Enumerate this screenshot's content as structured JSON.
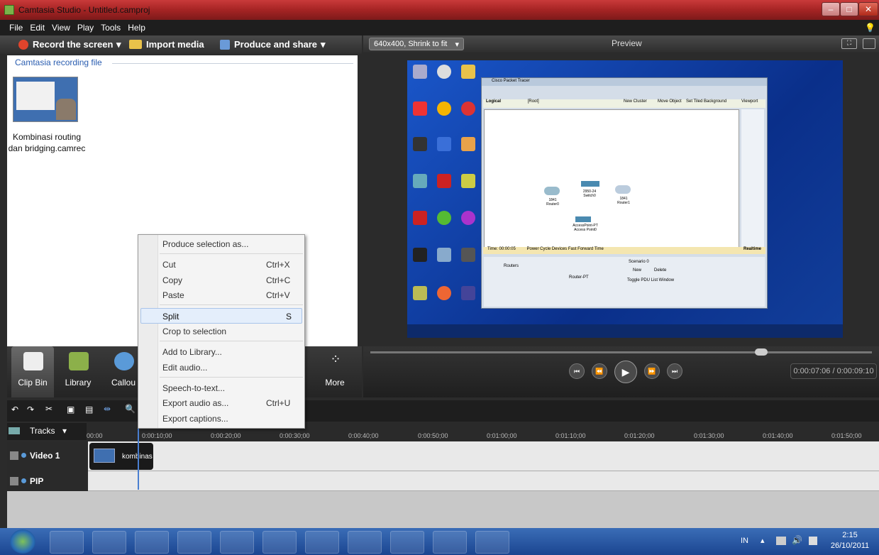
{
  "window": {
    "title": "Camtasia Studio - Untitled.camproj",
    "tip_icon": "lightbulb-icon"
  },
  "menu": [
    "File",
    "Edit",
    "View",
    "Play",
    "Tools",
    "Help"
  ],
  "toolbar": {
    "record": "Record the screen",
    "import": "Import media",
    "produce": "Produce and share"
  },
  "clipbin": {
    "heading": "Camtasia recording file",
    "clip_name_line1": "Kombinasi routing",
    "clip_name_line2": "dan bridging.camrec"
  },
  "preview": {
    "size_select": "640x400, Shrink to fit",
    "title": "Preview"
  },
  "packet_tracer": {
    "title": "Cisco Packet Tracer",
    "mode": "Logical",
    "root": "[Root]",
    "new_cluster": "New Cluster",
    "move_object": "Move Object",
    "set_bg": "Set Tiled Background",
    "viewport": "Viewport",
    "realtime": "Realtime",
    "time": "Time: 00:00:05",
    "power_cycle": "Power Cycle Devices  Fast Forward Time",
    "devices": [
      {
        "name": "1841\nRouter0"
      },
      {
        "name": "2950-24\nSwitch0"
      },
      {
        "name": "1841\nRouter1"
      },
      {
        "name": "AccessPoint-PT\nAccess Point0"
      }
    ],
    "routers": "Routers",
    "router_pt": "Router-PT",
    "scenario": "Scenario 0",
    "new": "New",
    "delete": "Delete",
    "toggle": "Toggle PDU List Window"
  },
  "player": {
    "timecode": "0:00:07:06 / 0:00:09:10"
  },
  "tabs": [
    {
      "label": "Clip Bin"
    },
    {
      "label": "Library"
    },
    {
      "label": "Callou"
    },
    {
      "label": "More"
    }
  ],
  "timeline": {
    "tracks_label": "Tracks",
    "ruler": [
      "00:00",
      "0:00:10;00",
      "0:00:20;00",
      "0:00:30;00",
      "0:00:40;00",
      "0:00:50;00",
      "0:01:00;00",
      "0:01:10;00",
      "0:01:20;00",
      "0:01:30;00",
      "0:01:40;00",
      "0:01:50;00"
    ],
    "track1": "Video 1",
    "track2": "PIP",
    "clip_label": "kombinas"
  },
  "context_menu": {
    "items": [
      {
        "label": "Produce selection as...",
        "shortcut": ""
      },
      {
        "label": "Cut",
        "shortcut": "Ctrl+X"
      },
      {
        "label": "Copy",
        "shortcut": "Ctrl+C"
      },
      {
        "label": "Paste",
        "shortcut": "Ctrl+V"
      },
      {
        "label": "Split",
        "shortcut": "S"
      },
      {
        "label": "Crop to selection",
        "shortcut": ""
      },
      {
        "label": "Add to Library...",
        "shortcut": ""
      },
      {
        "label": "Edit audio...",
        "shortcut": ""
      },
      {
        "label": "Speech-to-text...",
        "shortcut": ""
      },
      {
        "label": "Export audio as...",
        "shortcut": "Ctrl+U"
      },
      {
        "label": "Export captions...",
        "shortcut": ""
      }
    ]
  },
  "taskbar": {
    "lang": "IN",
    "time": "2:15",
    "date": "26/10/2011"
  }
}
